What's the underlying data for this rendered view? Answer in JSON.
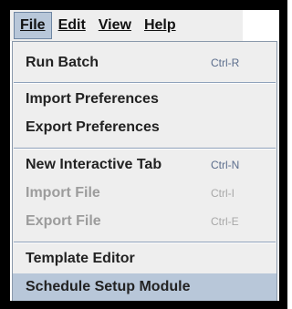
{
  "menubar": {
    "items": [
      {
        "label": "File",
        "active": true
      },
      {
        "label": "Edit"
      },
      {
        "label": "View"
      },
      {
        "label": "Help"
      }
    ]
  },
  "dropdown": {
    "items": [
      {
        "label": "Run Batch",
        "accelerator": "Ctrl-R",
        "enabled": true
      },
      {
        "label": "Import Preferences",
        "accelerator": "",
        "enabled": true
      },
      {
        "label": "Export Preferences",
        "accelerator": "",
        "enabled": true
      },
      {
        "label": "New Interactive Tab",
        "accelerator": "Ctrl-N",
        "enabled": true
      },
      {
        "label": "Import File",
        "accelerator": "Ctrl-I",
        "enabled": false
      },
      {
        "label": "Export File",
        "accelerator": "Ctrl-E",
        "enabled": false
      },
      {
        "label": "Template Editor",
        "accelerator": "",
        "enabled": true
      },
      {
        "label": "Schedule Setup Module",
        "accelerator": "",
        "enabled": true,
        "highlighted": true
      }
    ]
  },
  "colors": {
    "menu_bg": "#eeeeee",
    "highlight": "#b8c7d9",
    "accelerator": "#5b6d8c",
    "disabled_text": "#9c9c9c"
  }
}
